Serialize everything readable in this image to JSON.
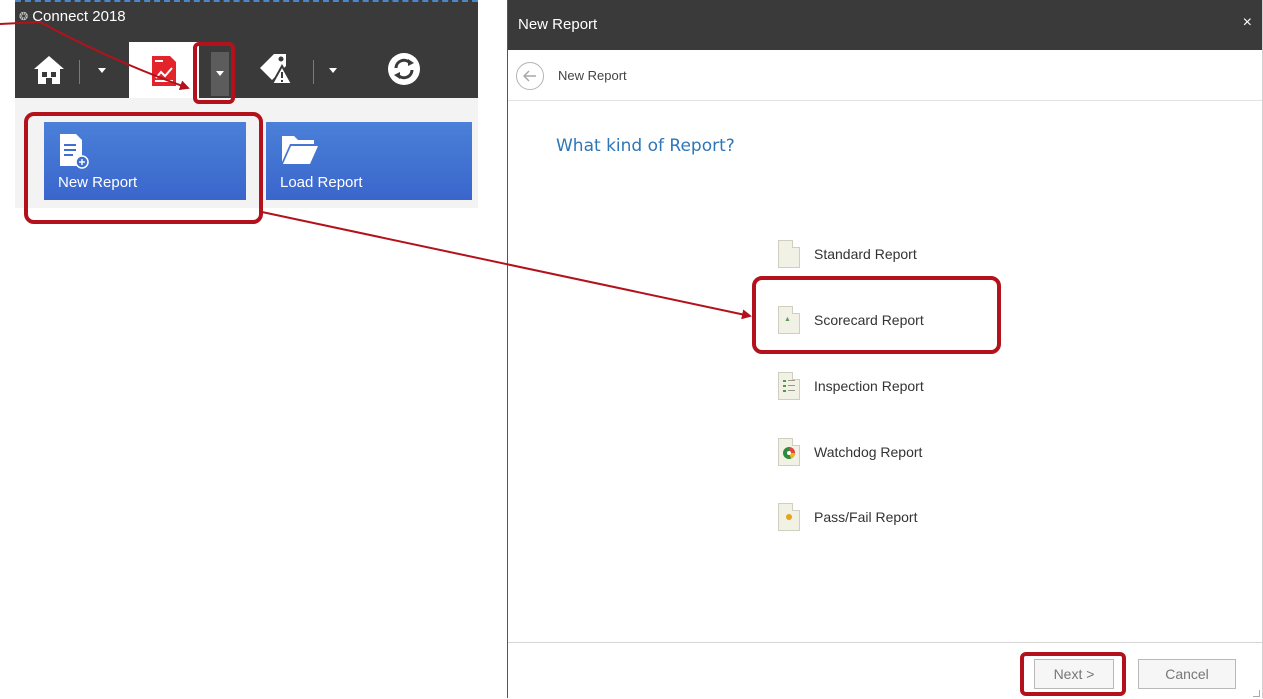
{
  "app": {
    "title": "Connect 2018",
    "toolbar": {
      "icons": [
        "home-icon",
        "report-chart-icon",
        "tag-warning-icon",
        "sync-icon"
      ]
    },
    "ribbon": {
      "tiles": [
        {
          "label": "New Report",
          "icon": "new-report-icon"
        },
        {
          "label": "Load Report",
          "icon": "folder-icon"
        }
      ]
    }
  },
  "dialog": {
    "title": "New Report",
    "close_glyph": "×",
    "nav_title": "New Report",
    "question": "What kind of Report?",
    "options": [
      {
        "label": "Standard Report",
        "icon": "standard-report-icon"
      },
      {
        "label": "Scorecard Report",
        "icon": "scorecard-report-icon"
      },
      {
        "label": "Inspection Report",
        "icon": "inspection-report-icon"
      },
      {
        "label": "Watchdog Report",
        "icon": "watchdog-report-icon"
      },
      {
        "label": "Pass/Fail Report",
        "icon": "pass-fail-report-icon"
      }
    ],
    "buttons": {
      "next": "Next >",
      "cancel": "Cancel"
    }
  },
  "colors": {
    "header_dark": "#3a3a3a",
    "tile_blue": "#3f6fd1",
    "question_blue": "#2f76b8",
    "annotation_red": "#b3121c"
  }
}
